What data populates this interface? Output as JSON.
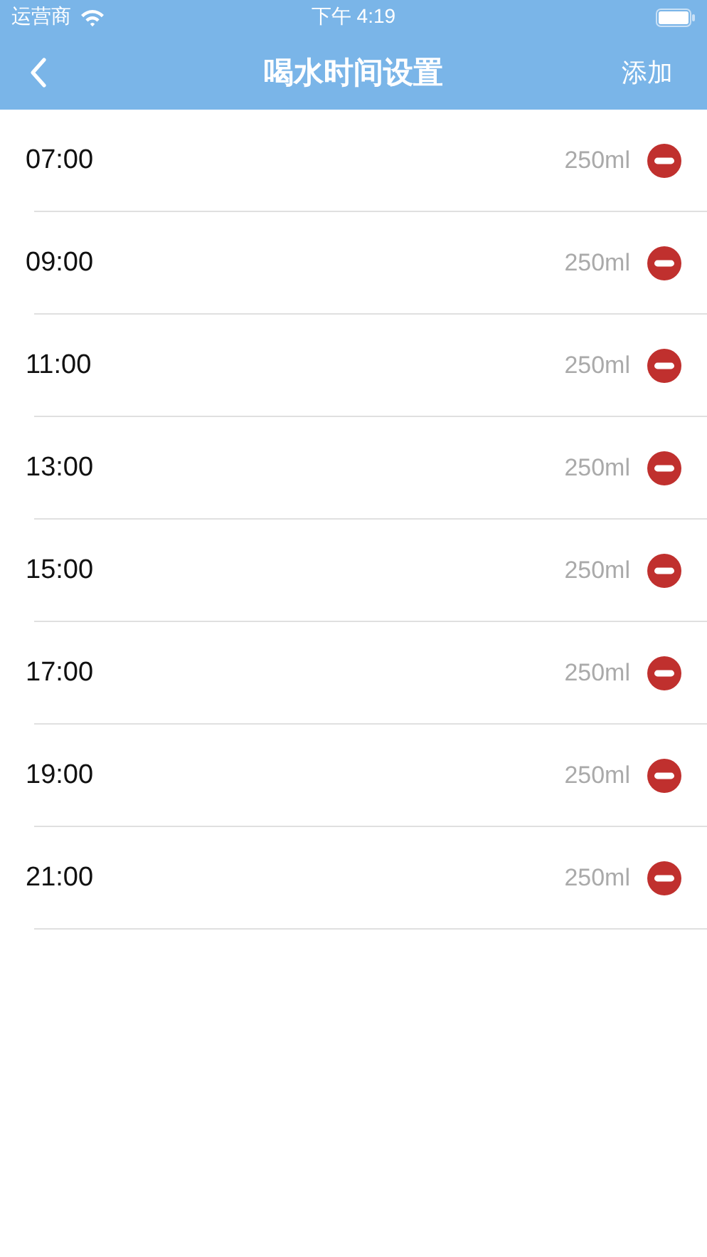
{
  "status_bar": {
    "carrier": "运营商",
    "time": "下午 4:19"
  },
  "nav_bar": {
    "title": "喝水时间设置",
    "action": "添加"
  },
  "reminders": [
    {
      "time": "07:00",
      "amount": "250ml"
    },
    {
      "time": "09:00",
      "amount": "250ml"
    },
    {
      "time": "11:00",
      "amount": "250ml"
    },
    {
      "time": "13:00",
      "amount": "250ml"
    },
    {
      "time": "15:00",
      "amount": "250ml"
    },
    {
      "time": "17:00",
      "amount": "250ml"
    },
    {
      "time": "19:00",
      "amount": "250ml"
    },
    {
      "time": "21:00",
      "amount": "250ml"
    }
  ]
}
